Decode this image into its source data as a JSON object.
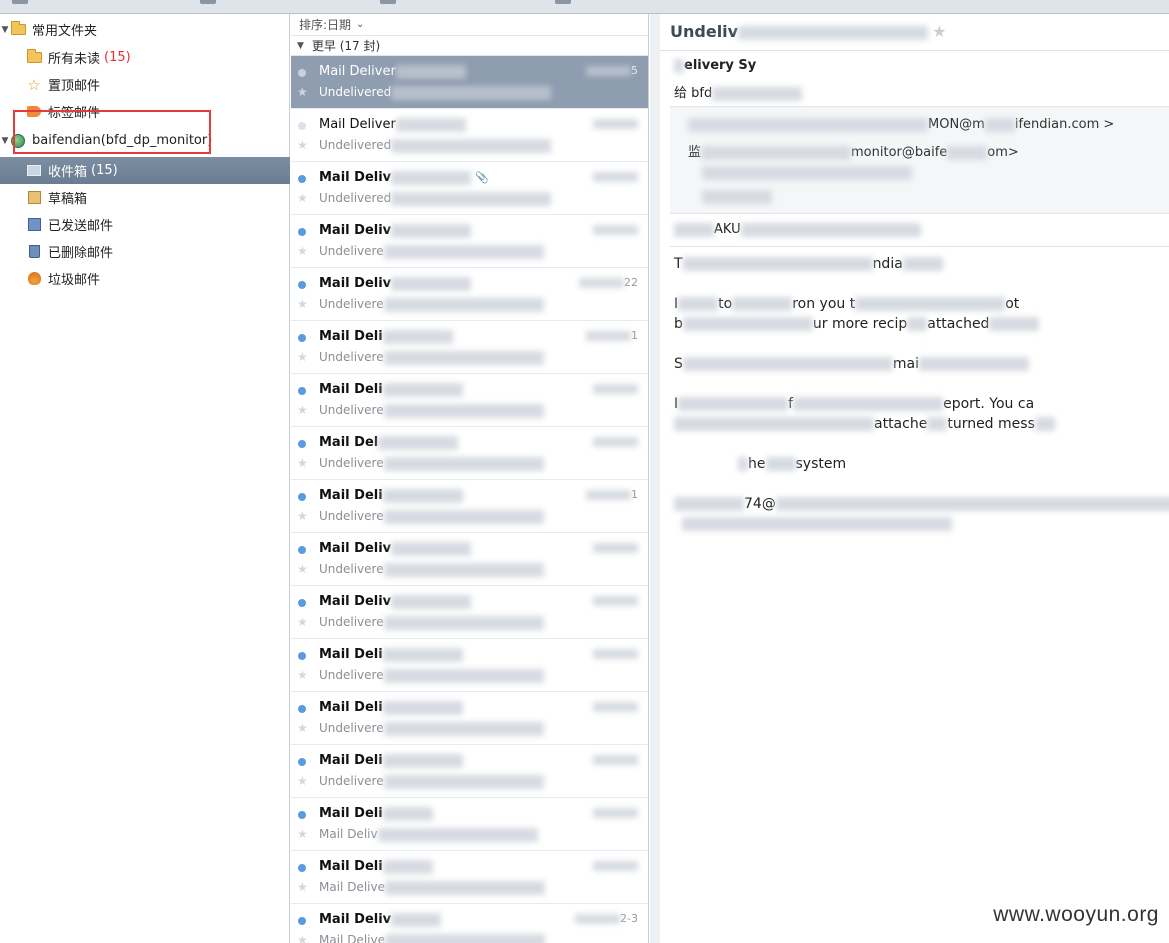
{
  "sidebar": {
    "common_folder": "常用文件夹",
    "items_common": [
      {
        "label": "所有未读",
        "count": "(15)"
      },
      {
        "label": "置顶邮件",
        "count": ""
      },
      {
        "label": "标签邮件",
        "count": ""
      }
    ],
    "account": "baifendian(bfd_dp_monitor)",
    "items_account": [
      {
        "label": "收件箱",
        "count": "(15)"
      },
      {
        "label": "草稿箱",
        "count": ""
      },
      {
        "label": "已发送邮件",
        "count": ""
      },
      {
        "label": "已删除邮件",
        "count": ""
      },
      {
        "label": "垃圾邮件",
        "count": ""
      }
    ]
  },
  "list": {
    "sort_label": "排序:日期",
    "group_label": "更早 (17 封)",
    "messages": [
      {
        "sender": "Mail Deliver",
        "subject": "Undelivered",
        "date": "5",
        "unread": false
      },
      {
        "sender": "Mail Deliver",
        "subject": "Undelivered",
        "date": "",
        "unread": false
      },
      {
        "sender": "Mail Deliv",
        "subject": "Undelivered",
        "date": "",
        "unread": true
      },
      {
        "sender": "Mail Deliv",
        "subject": "Undelivere",
        "date": "",
        "unread": true
      },
      {
        "sender": "Mail Deliv",
        "subject": "Undelivere",
        "date": "22",
        "unread": true
      },
      {
        "sender": "Mail Deli",
        "subject": "Undelivere",
        "date": "1",
        "unread": true
      },
      {
        "sender": "Mail Deli",
        "subject": "Undelivere",
        "date": "",
        "unread": true
      },
      {
        "sender": "Mail Del",
        "subject": "Undelivere",
        "date": "",
        "unread": true
      },
      {
        "sender": "Mail Deli",
        "subject": "Undelivere",
        "date": "1",
        "unread": true
      },
      {
        "sender": "Mail Deliv",
        "subject": "Undelivere",
        "date": "",
        "unread": true
      },
      {
        "sender": "Mail Deliv",
        "subject": "Undelivere",
        "date": "",
        "unread": true
      },
      {
        "sender": "Mail Deli",
        "subject": "Undelivere",
        "date": "",
        "unread": true
      },
      {
        "sender": "Mail Deli",
        "subject": "Undelivere",
        "date": "",
        "unread": true
      },
      {
        "sender": "Mail Deli",
        "subject": "Undelivere",
        "date": "",
        "unread": true
      },
      {
        "sender": "Mail Deli",
        "subject": "Mail Deliv",
        "date": "",
        "unread": true
      },
      {
        "sender": "Mail Deli",
        "subject": "Mail Delive",
        "date": "",
        "unread": true
      },
      {
        "sender": "Mail Deliv",
        "subject": "Mail Delive",
        "date": "2-3",
        "unread": true
      }
    ]
  },
  "reader": {
    "title": "Undeliv",
    "from": "elivery Sy",
    "to": "给 bfd",
    "header_lines": [
      "MON@m",
      "ifendian.com >",
      "监",
      "monitor@baife",
      "om>"
    ],
    "date_line": "AKU",
    "body": [
      "T",
      "ndia",
      "I",
      "to",
      "ron you t",
      "ot",
      "b",
      "ur more recip",
      "attached",
      "S",
      "mai",
      "I",
      "f",
      "eport. You ca",
      "",
      "attache",
      "turned mess",
      "",
      "he",
      "system",
      "",
      "74@"
    ]
  },
  "watermark": "www.wooyun.org"
}
